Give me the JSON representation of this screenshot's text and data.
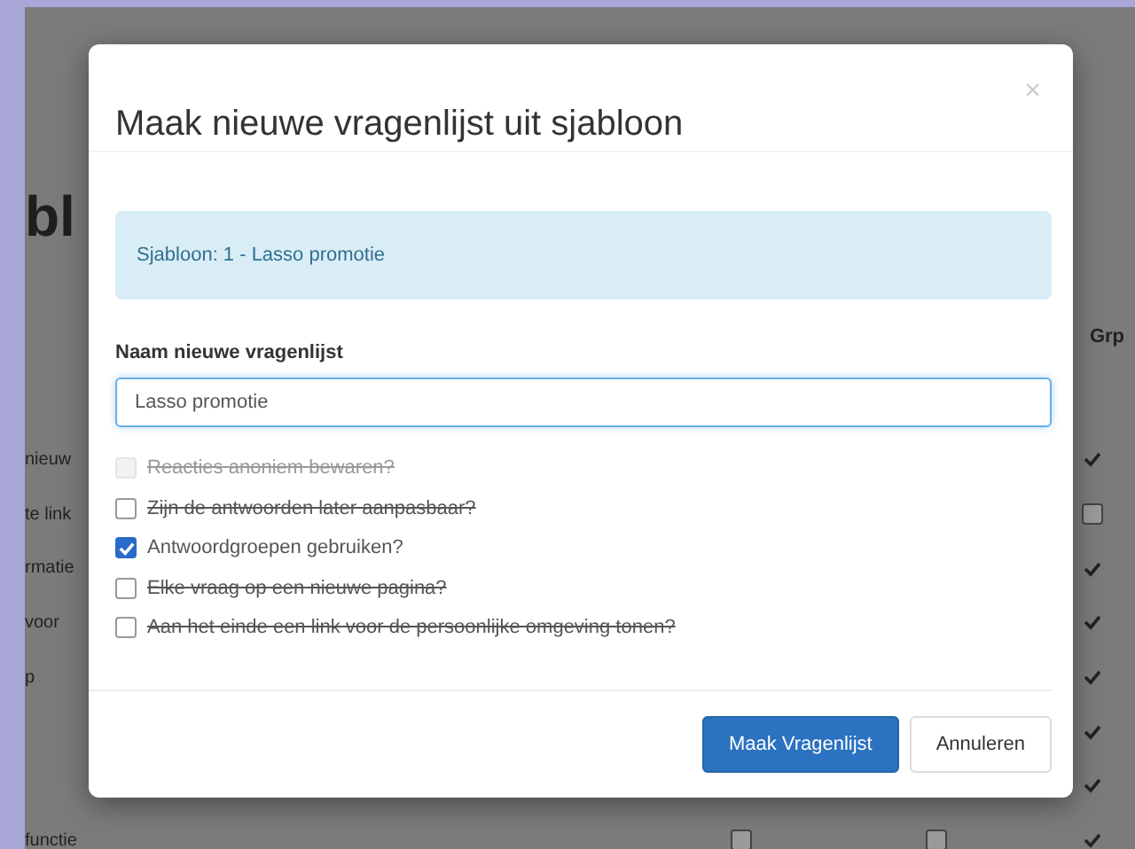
{
  "background": {
    "heading": "bl",
    "column_header": "Grp",
    "rows": [
      {
        "label": "nieuw",
        "grp": true
      },
      {
        "label": "te link",
        "grp": false
      },
      {
        "label": "rmatie",
        "grp": true
      },
      {
        "label": "voor",
        "grp": true
      },
      {
        "label": "p",
        "grp": true
      },
      {
        "grp": true
      },
      {
        "grp": true
      },
      {
        "label": "functie",
        "grp": true,
        "extra": [
          false,
          false
        ]
      }
    ]
  },
  "dialog": {
    "title": "Maak nieuwe vragenlijst uit sjabloon",
    "close": "×",
    "info": "Sjabloon: 1 - Lasso promotie",
    "field_label": "Naam nieuwe vragenlijst",
    "field_value": "Lasso promotie",
    "options": [
      {
        "label": "Reacties anoniem bewaren?",
        "checked": false,
        "disabled": true,
        "struck": true
      },
      {
        "label": "Zijn de antwoorden later aanpasbaar?",
        "checked": false,
        "disabled": false,
        "struck": true
      },
      {
        "label": "Antwoordgroepen gebruiken?",
        "checked": true,
        "disabled": false,
        "struck": false
      },
      {
        "label": "Elke vraag op een nieuwe pagina?",
        "checked": false,
        "disabled": false,
        "struck": true
      },
      {
        "label": "Aan het einde een link voor de persoonlijke omgeving tonen?",
        "checked": false,
        "disabled": false,
        "struck": true
      }
    ],
    "buttons": [
      {
        "label": "Maak Vragenlijst",
        "kind": "primary"
      },
      {
        "label": "Annuleren",
        "kind": "default"
      }
    ]
  }
}
